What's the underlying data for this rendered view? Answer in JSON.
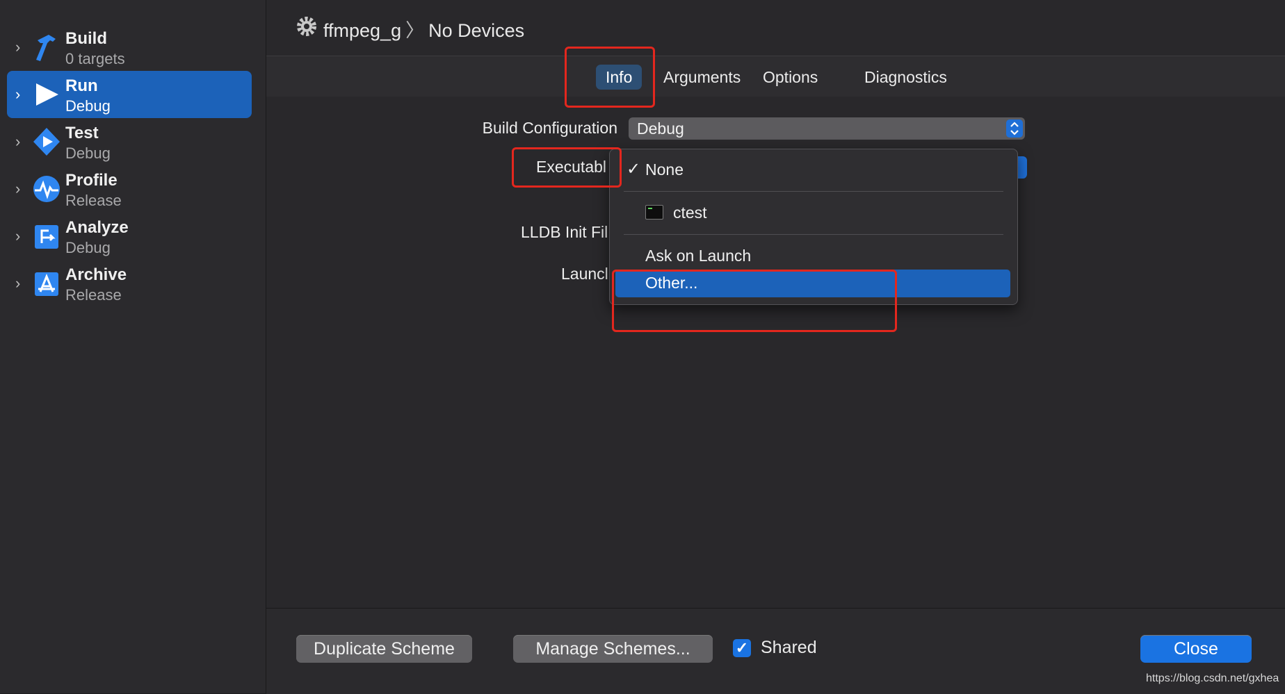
{
  "sidebar": {
    "items": [
      {
        "title": "Build",
        "subtitle": "0 targets",
        "icon": "hammer-icon"
      },
      {
        "title": "Run",
        "subtitle": "Debug",
        "icon": "play-icon",
        "selected": true
      },
      {
        "title": "Test",
        "subtitle": "Debug",
        "icon": "test-diamond-icon"
      },
      {
        "title": "Profile",
        "subtitle": "Release",
        "icon": "waveform-icon"
      },
      {
        "title": "Analyze",
        "subtitle": "Debug",
        "icon": "analyze-icon"
      },
      {
        "title": "Archive",
        "subtitle": "Release",
        "icon": "archive-a-icon"
      }
    ]
  },
  "header": {
    "scheme": "ffmpeg_g",
    "separator": "〉",
    "destination": "No Devices"
  },
  "tabs": [
    {
      "label": "Info",
      "active": true
    },
    {
      "label": "Arguments"
    },
    {
      "label": "Options"
    },
    {
      "label": "Diagnostics"
    }
  ],
  "form": {
    "build_configuration_label": "Build Configuration",
    "build_configuration_value": "Debug",
    "executable_label": "Executabl",
    "lldb_label": "LLDB Init Fil",
    "launch_label": "Launcl"
  },
  "menu": {
    "none": "None",
    "checkmark": "✓",
    "ctest": "ctest",
    "ask": "Ask on Launch",
    "other": "Other..."
  },
  "footer": {
    "duplicate": "Duplicate Scheme",
    "manage": "Manage Schemes...",
    "shared_label": "Shared",
    "shared_checked": true,
    "checkmark": "✓",
    "close": "Close"
  },
  "watermark": "https://blog.csdn.net/gxhea",
  "colors": {
    "accent": "#1c62b9",
    "annotation": "#e3271e",
    "background": "#29282b"
  }
}
